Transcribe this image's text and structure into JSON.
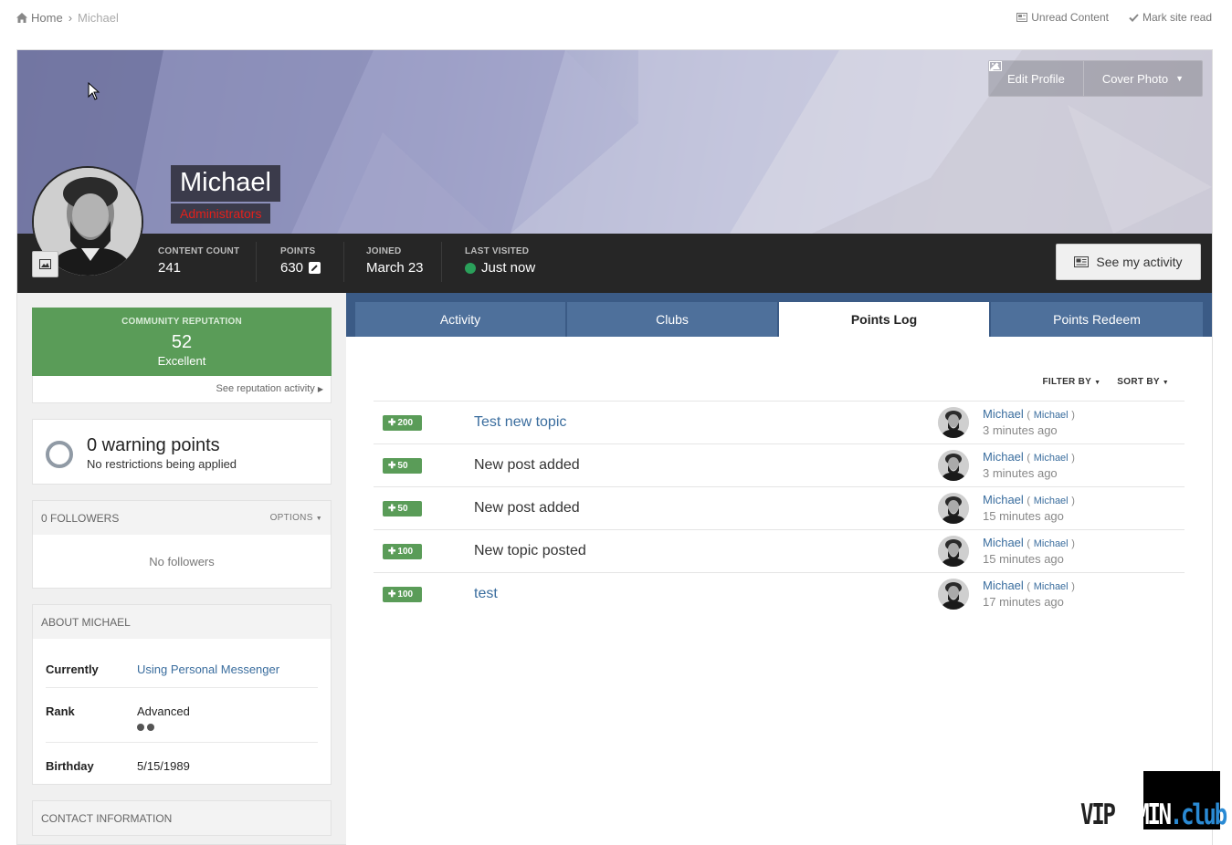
{
  "breadcrumb": {
    "home": "Home",
    "current": "Michael"
  },
  "top_links": {
    "unread": "Unread Content",
    "mark_read": "Mark site read"
  },
  "cover": {
    "edit_profile": "Edit Profile",
    "cover_photo": "Cover Photo"
  },
  "profile": {
    "name": "Michael",
    "group": "Administrators",
    "group_color": "#e3201b"
  },
  "stats": [
    {
      "label": "CONTENT COUNT",
      "value": "241"
    },
    {
      "label": "POINTS",
      "value": "630"
    },
    {
      "label": "JOINED",
      "value": "March 23"
    },
    {
      "label": "LAST VISITED",
      "value": "Just now"
    }
  ],
  "activity_button": "See my activity",
  "reputation": {
    "label": "COMMUNITY REPUTATION",
    "value": "52",
    "text": "Excellent",
    "link": "See reputation activity",
    "color": "#5a9c58"
  },
  "warnings": {
    "title": "0 warning points",
    "subtitle": "No restrictions being applied"
  },
  "followers": {
    "title": "0 FOLLOWERS",
    "options": "OPTIONS",
    "empty": "No followers"
  },
  "about": {
    "title": "ABOUT MICHAEL",
    "rows": [
      {
        "key": "Currently",
        "value": "Using Personal Messenger"
      },
      {
        "key": "Rank",
        "value": "Advanced"
      },
      {
        "key": "Birthday",
        "value": "5/15/1989"
      }
    ]
  },
  "contact": {
    "title": "CONTACT INFORMATION"
  },
  "tabs": [
    {
      "label": "Activity"
    },
    {
      "label": "Clubs"
    },
    {
      "label": "Points Log"
    },
    {
      "label": "Points Redeem"
    }
  ],
  "filters": {
    "filter_by": "FILTER BY",
    "sort_by": "SORT BY"
  },
  "points_log": [
    {
      "points": "200",
      "title": "Test new topic",
      "user": "Michael",
      "user_small": "Michael",
      "time": "3 minutes ago"
    },
    {
      "points": "50",
      "title": "New post added",
      "user": "Michael",
      "user_small": "Michael",
      "time": "3 minutes ago"
    },
    {
      "points": "50",
      "title": "New post added",
      "user": "Michael",
      "user_small": "Michael",
      "time": "15 minutes ago"
    },
    {
      "points": "100",
      "title": "New topic posted",
      "user": "Michael",
      "user_small": "Michael",
      "time": "15 minutes ago"
    },
    {
      "points": "100",
      "title": "test",
      "user": "Michael",
      "user_small": "Michael",
      "time": "17 minutes ago"
    }
  ],
  "watermark": {
    "prefix": "VIP",
    "mid": "ADMIN",
    "suffix": ".club"
  }
}
